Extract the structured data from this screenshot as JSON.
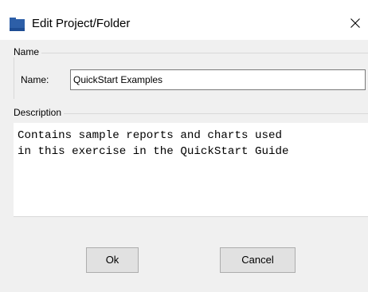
{
  "dialog": {
    "title": "Edit Project/Folder",
    "close_glyph": "✕",
    "app_icon": "folder-project-icon",
    "accent_color": "#2d5fa8"
  },
  "name_group": {
    "legend": "Name",
    "field_label": "Name:",
    "value": "QuickStart Examples"
  },
  "description_group": {
    "legend": "Description",
    "text": "Contains sample reports and charts used\nin this exercise in the QuickStart Guide"
  },
  "buttons": {
    "ok_label": "Ok",
    "cancel_label": "Cancel"
  }
}
